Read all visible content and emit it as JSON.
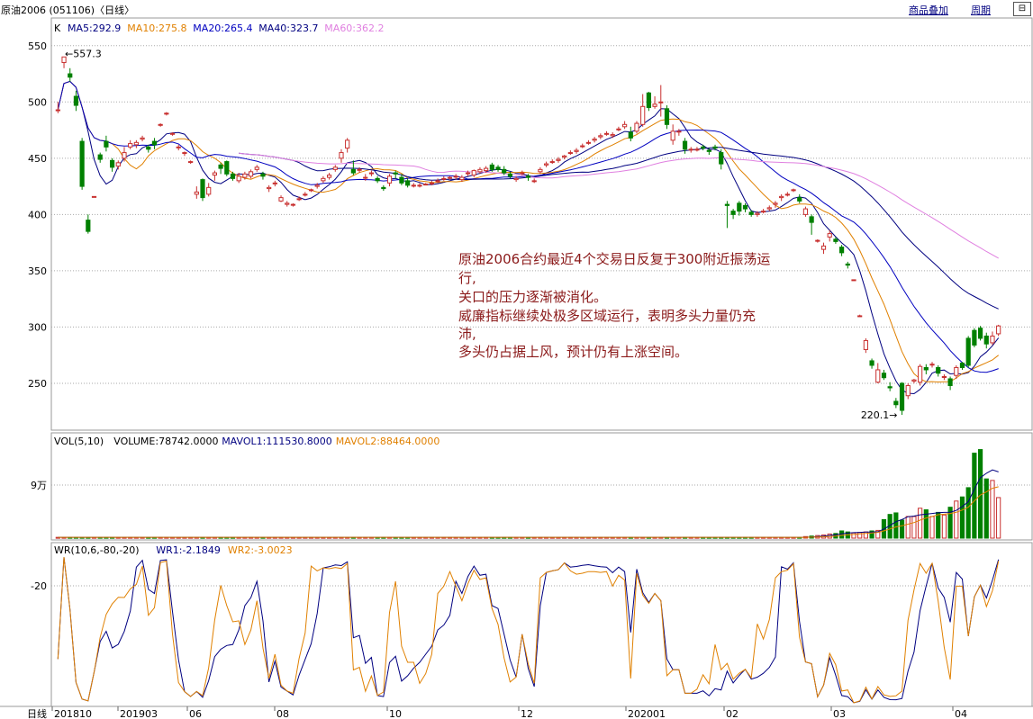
{
  "title_bar": {
    "title": "原油2006 (051106)〈日线〉",
    "overlay_button": "商品叠加",
    "period_button": "周期",
    "float_button": "⊟"
  },
  "colors": {
    "up": "#c8302f",
    "down": "#008000",
    "ma5": "#000080",
    "ma10": "#e08000",
    "ma20": "#0000c0",
    "ma40": "#000080",
    "ma60": "#e080e0",
    "grid": "#aaaaaa",
    "wr1": "#000080",
    "wr2": "#e08000"
  },
  "price_panel": {
    "label": "K",
    "legend": [
      {
        "text": "MA5:292.9",
        "color": "#000080"
      },
      {
        "text": "MA10:275.8",
        "color": "#e08000"
      },
      {
        "text": "MA20:265.4",
        "color": "#0000c0"
      },
      {
        "text": "MA40:323.7",
        "color": "#000080"
      },
      {
        "text": "MA60:362.2",
        "color": "#e080e0"
      }
    ],
    "high_marker": "←557.3",
    "low_marker": "220.1→",
    "annotation": [
      "原油2006合约最近4个交易日反复于300附近振荡运",
      "行,",
      "关口的压力逐渐被消化。",
      "威廉指标继续处极多区域运行，表明多头力量仍充",
      "沛,",
      "多头仍占据上风，预计仍有上涨空间。"
    ]
  },
  "volume_panel": {
    "legend": [
      {
        "text": "VOL(5,10)",
        "color": "#000000"
      },
      {
        "text": "VOLUME:78742.0000",
        "color": "#000000"
      },
      {
        "text": "MAVOL1:111530.8000",
        "color": "#000080"
      },
      {
        "text": "MAVOL2:88464.0000",
        "color": "#e08000"
      }
    ],
    "y_tick": "9万"
  },
  "wr_panel": {
    "legend": [
      {
        "text": "WR(10,6,-80,-20)",
        "color": "#000000"
      },
      {
        "text": "WR1:-2.1849",
        "color": "#000080"
      },
      {
        "text": "WR2:-3.0023",
        "color": "#e08000"
      }
    ],
    "y_tick": "-20"
  },
  "x_axis": {
    "period_label": "日线",
    "labels": [
      "201810",
      "201903",
      "06",
      "08",
      "10",
      "12",
      "202001",
      "02",
      "03",
      "04"
    ]
  },
  "chart_data": [
    {
      "type": "candlestick",
      "title": "原油2006 (051106)〈日线〉",
      "ylim": [
        210,
        565
      ],
      "yticks": [
        250,
        300,
        350,
        400,
        450,
        500,
        550
      ],
      "x_labels": [
        "201810",
        "201903",
        "06",
        "08",
        "10",
        "12",
        "202001",
        "02",
        "03",
        "04"
      ],
      "candles": [
        [
          493,
          493,
          500,
          490
        ],
        [
          535,
          540,
          540,
          530
        ],
        [
          525,
          522,
          530,
          518
        ],
        [
          505,
          497,
          510,
          492
        ],
        [
          465,
          425,
          468,
          422
        ],
        [
          395,
          385,
          400,
          383
        ],
        [
          416,
          416,
          416,
          416
        ],
        [
          453,
          449,
          455,
          446
        ],
        [
          465,
          460,
          470,
          456
        ],
        [
          448,
          442,
          450,
          438
        ],
        [
          443,
          446,
          448,
          440
        ],
        [
          450,
          455,
          460,
          447
        ],
        [
          460,
          463,
          466,
          458
        ],
        [
          462,
          464,
          466,
          459
        ],
        [
          467,
          468,
          470,
          465
        ],
        [
          460,
          458,
          462,
          455
        ],
        [
          465,
          462,
          468,
          458
        ],
        [
          480,
          480,
          481,
          478
        ],
        [
          490,
          490,
          491,
          488
        ],
        [
          472,
          472,
          473,
          470
        ],
        [
          460,
          460,
          462,
          457
        ],
        [
          455,
          455,
          456,
          452
        ],
        [
          447,
          447,
          448,
          445
        ],
        [
          418,
          420,
          425,
          414
        ],
        [
          431,
          415,
          432,
          412
        ],
        [
          418,
          424,
          428,
          416
        ],
        [
          435,
          437,
          439,
          430
        ],
        [
          444,
          441,
          446,
          436
        ],
        [
          447,
          436,
          448,
          434
        ],
        [
          436,
          432,
          438,
          430
        ],
        [
          430,
          434,
          437,
          428
        ],
        [
          433,
          436,
          438,
          431
        ],
        [
          434,
          438,
          440,
          432
        ],
        [
          440,
          442,
          444,
          438
        ],
        [
          436,
          434,
          438,
          431
        ],
        [
          423,
          424,
          426,
          420
        ],
        [
          428,
          428,
          430,
          425
        ],
        [
          412,
          415,
          417,
          411
        ],
        [
          409,
          410,
          412,
          407
        ],
        [
          409,
          409,
          410,
          407
        ],
        [
          414,
          414,
          416,
          412
        ],
        [
          418,
          418,
          420,
          416
        ],
        [
          422,
          422,
          423,
          420
        ],
        [
          425,
          426,
          428,
          423
        ],
        [
          430,
          432,
          434,
          428
        ],
        [
          433,
          435,
          437,
          431
        ],
        [
          440,
          442,
          444,
          438
        ],
        [
          450,
          455,
          458,
          446
        ],
        [
          459,
          466,
          468,
          455
        ],
        [
          440,
          437,
          448,
          435
        ],
        [
          440,
          440,
          442,
          437
        ],
        [
          433,
          433,
          436,
          430
        ],
        [
          437,
          437,
          439,
          434
        ],
        [
          432,
          430,
          434,
          428
        ],
        [
          424,
          423,
          426,
          421
        ],
        [
          428,
          434,
          436,
          425
        ],
        [
          437,
          436,
          439,
          432
        ],
        [
          433,
          428,
          436,
          426
        ],
        [
          430,
          426,
          432,
          424
        ],
        [
          426,
          426,
          428,
          424
        ],
        [
          426,
          426,
          428,
          424
        ],
        [
          427,
          427,
          428,
          426
        ],
        [
          428,
          428,
          430,
          426
        ],
        [
          430,
          430,
          432,
          428
        ],
        [
          432,
          432,
          434,
          430
        ],
        [
          433,
          433,
          434,
          431
        ],
        [
          434,
          434,
          436,
          431
        ],
        [
          431,
          433,
          435,
          429
        ],
        [
          437,
          437,
          439,
          434
        ],
        [
          435,
          439,
          440,
          433
        ],
        [
          438,
          440,
          442,
          436
        ],
        [
          439,
          441,
          443,
          437
        ],
        [
          444,
          440,
          446,
          438
        ],
        [
          442,
          440,
          444,
          438
        ],
        [
          440,
          437,
          443,
          435
        ],
        [
          436,
          434,
          438,
          432
        ],
        [
          431,
          432,
          434,
          429
        ],
        [
          437,
          437,
          439,
          435
        ],
        [
          434,
          433,
          436,
          430
        ],
        [
          430,
          430,
          432,
          428
        ],
        [
          438,
          440,
          442,
          436
        ],
        [
          444,
          445,
          447,
          442
        ],
        [
          447,
          447,
          449,
          445
        ],
        [
          448,
          449,
          451,
          446
        ],
        [
          451,
          452,
          453,
          449
        ],
        [
          455,
          455,
          457,
          453
        ],
        [
          456,
          457,
          459,
          454
        ],
        [
          461,
          461,
          463,
          459
        ],
        [
          464,
          464,
          466,
          462
        ],
        [
          466,
          467,
          469,
          464
        ],
        [
          469,
          470,
          472,
          467
        ],
        [
          472,
          472,
          474,
          470
        ],
        [
          470,
          471,
          473,
          468
        ],
        [
          476,
          476,
          478,
          474
        ],
        [
          478,
          480,
          483,
          476
        ],
        [
          473,
          468,
          478,
          465
        ],
        [
          474,
          481,
          483,
          472
        ],
        [
          480,
          496,
          507,
          478
        ],
        [
          508,
          495,
          509,
          492
        ],
        [
          496,
          498,
          505,
          494
        ],
        [
          500,
          500,
          515,
          487
        ],
        [
          494,
          480,
          497,
          476
        ],
        [
          466,
          474,
          480,
          462
        ],
        [
          474,
          474,
          476,
          470
        ],
        [
          465,
          458,
          468,
          454
        ],
        [
          458,
          458,
          460,
          455
        ],
        [
          458,
          458,
          460,
          456
        ],
        [
          460,
          459,
          462,
          457
        ],
        [
          457,
          456,
          459,
          453
        ],
        [
          460,
          459,
          462,
          457
        ],
        [
          455,
          445,
          458,
          440
        ],
        [
          409,
          408,
          412,
          388
        ],
        [
          403,
          400,
          405,
          396
        ],
        [
          410,
          403,
          412,
          399
        ],
        [
          408,
          405,
          410,
          402
        ],
        [
          402,
          400,
          404,
          398
        ],
        [
          400,
          401,
          403,
          398
        ],
        [
          403,
          403,
          405,
          401
        ],
        [
          405,
          406,
          408,
          403
        ],
        [
          409,
          410,
          412,
          406
        ],
        [
          415,
          416,
          418,
          412
        ],
        [
          418,
          418,
          420,
          416
        ],
        [
          422,
          422,
          423,
          420
        ],
        [
          415,
          412,
          418,
          410
        ],
        [
          400,
          405,
          407,
          398
        ],
        [
          398,
          393,
          400,
          382
        ],
        [
          377,
          377,
          378,
          375
        ],
        [
          369,
          372,
          375,
          365
        ],
        [
          380,
          383,
          386,
          376
        ],
        [
          378,
          376,
          380,
          374
        ],
        [
          371,
          366,
          373,
          363
        ],
        [
          356,
          355,
          358,
          352
        ],
        [
          342,
          342,
          342,
          342
        ],
        [
          310,
          310,
          311,
          309
        ],
        [
          280,
          288,
          290,
          277
        ],
        [
          270,
          266,
          272,
          263
        ],
        [
          251,
          262,
          268,
          250
        ],
        [
          259,
          255,
          262,
          253
        ],
        [
          247,
          246,
          251,
          243
        ],
        [
          234,
          231,
          237,
          228
        ],
        [
          250,
          226,
          251,
          222
        ],
        [
          239,
          248,
          250,
          236
        ],
        [
          252,
          253,
          254,
          250
        ],
        [
          251,
          265,
          267,
          248
        ],
        [
          264,
          262,
          267,
          258
        ],
        [
          267,
          267,
          269,
          264
        ],
        [
          264,
          259,
          266,
          256
        ],
        [
          256,
          256,
          258,
          253
        ],
        [
          254,
          248,
          256,
          244
        ],
        [
          257,
          264,
          266,
          254
        ],
        [
          268,
          264,
          269,
          262
        ],
        [
          290,
          266,
          292,
          264
        ],
        [
          297,
          284,
          299,
          282
        ],
        [
          299,
          290,
          301,
          288
        ],
        [
          292,
          285,
          295,
          281
        ],
        [
          286,
          292,
          296,
          284
        ],
        [
          294,
          301,
          302,
          292
        ]
      ]
    },
    {
      "type": "bar",
      "title": "VOL(5,10)",
      "series": [
        {
          "name": "VOLUME",
          "last": 78742
        }
      ],
      "mavol1_last": 111530.8,
      "mavol2_last": 88464,
      "volume_bars_recent": [
        3000,
        4000,
        5000,
        6000,
        8000,
        9000,
        14000,
        12000,
        10000,
        11000,
        12000,
        14000,
        15000,
        36000,
        46000,
        49000,
        35000,
        42000,
        42000,
        58000,
        55000,
        42000,
        50000,
        45000,
        60000,
        72000,
        80000,
        98000,
        165000,
        172000,
        115000,
        112000,
        78742
      ]
    },
    {
      "type": "line",
      "title": "WR(10,6,-80,-20)",
      "series": [
        {
          "name": "WR1",
          "last": -2.1849
        },
        {
          "name": "WR2",
          "last": -3.0023
        }
      ]
    }
  ]
}
